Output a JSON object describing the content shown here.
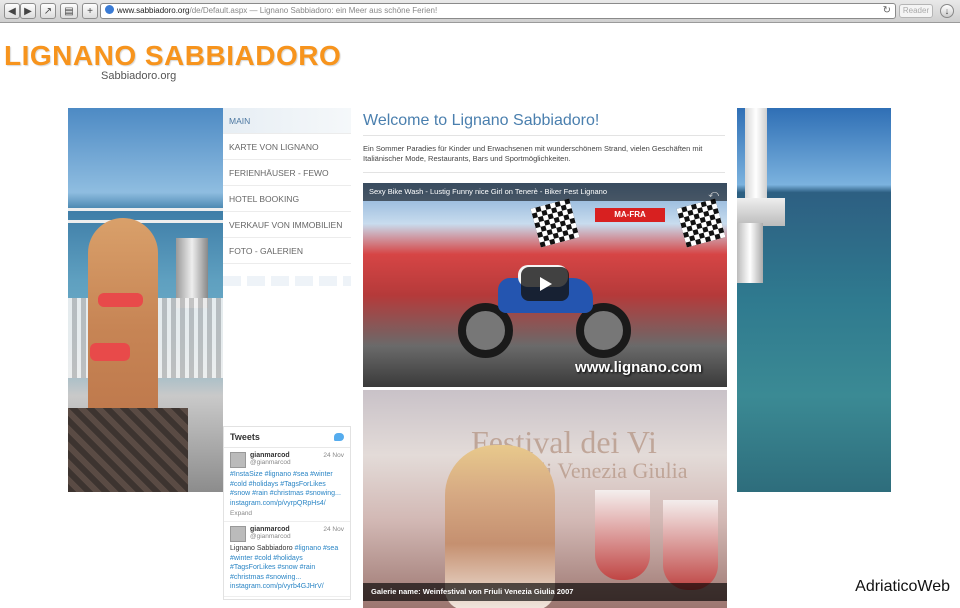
{
  "browser": {
    "url_main": "www.sabbiadoro.org",
    "url_path": "/de/Default.aspx",
    "page_title": " — Lignano Sabbiadoro: ein Meer aus schöne Ferien!",
    "reader_label": "Reader"
  },
  "header": {
    "title": "LIGNANO SABBIADORO",
    "subtitle": "Sabbiadoro.org"
  },
  "nav": {
    "items": [
      {
        "label": "MAIN"
      },
      {
        "label": "KARTE VON LIGNANO"
      },
      {
        "label": "FERIENHÄUSER - FEWO"
      },
      {
        "label": "HOTEL BOOKING"
      },
      {
        "label": "VERKAUF VON IMMOBILIEN"
      },
      {
        "label": "FOTO - GALERIEN"
      }
    ]
  },
  "main": {
    "title": "Welcome to Lignano Sabbiadoro!",
    "intro": "Ein Sommer Paradies für Kinder und Erwachsenen mit wunderschönem Strand, vielen Geschäften mit Italiänischer Mode, Restaurants, Bars und Sportmöglichkeiten.",
    "video_title": "Sexy Bike Wash - Lustig Funny nice Girl on Tenerè - Biker Fest Lignano",
    "video_banner": "MA-FRA",
    "video_watermark": "www.lignano.com",
    "gallery_line1": "Festival dei Vi",
    "gallery_line2": "del Friuli Venezia Giulia",
    "gallery_caption": "Galerie name: Weinfestival von Friuli Venezia Giulia 2007"
  },
  "tweets": {
    "heading": "Tweets",
    "items": [
      {
        "user": "gianmarcod",
        "handle": "@gianmarcod",
        "date": "24 Nov",
        "text": "#InstaSize #lignano #sea #winter #cold #holidays #TagsForLikes #snow #rain #christmas #snowing... instagram.com/p/vyrpQRpHs4/",
        "expand": "Expand"
      },
      {
        "user": "gianmarcod",
        "handle": "@gianmarcod",
        "date": "24 Nov",
        "text_plain": "Lignano Sabbiadoro",
        "text": "#lignano #sea #winter #cold #holidays #TagsForLikes #snow #rain #christmas #snowing... instagram.com/p/vyrb4GJHrV/"
      }
    ]
  },
  "watermark": "AdriaticoWeb",
  "colors": {
    "title_orange": "#f7941d",
    "link_blue": "#4a7fae",
    "twitter_blue": "#55acee"
  }
}
